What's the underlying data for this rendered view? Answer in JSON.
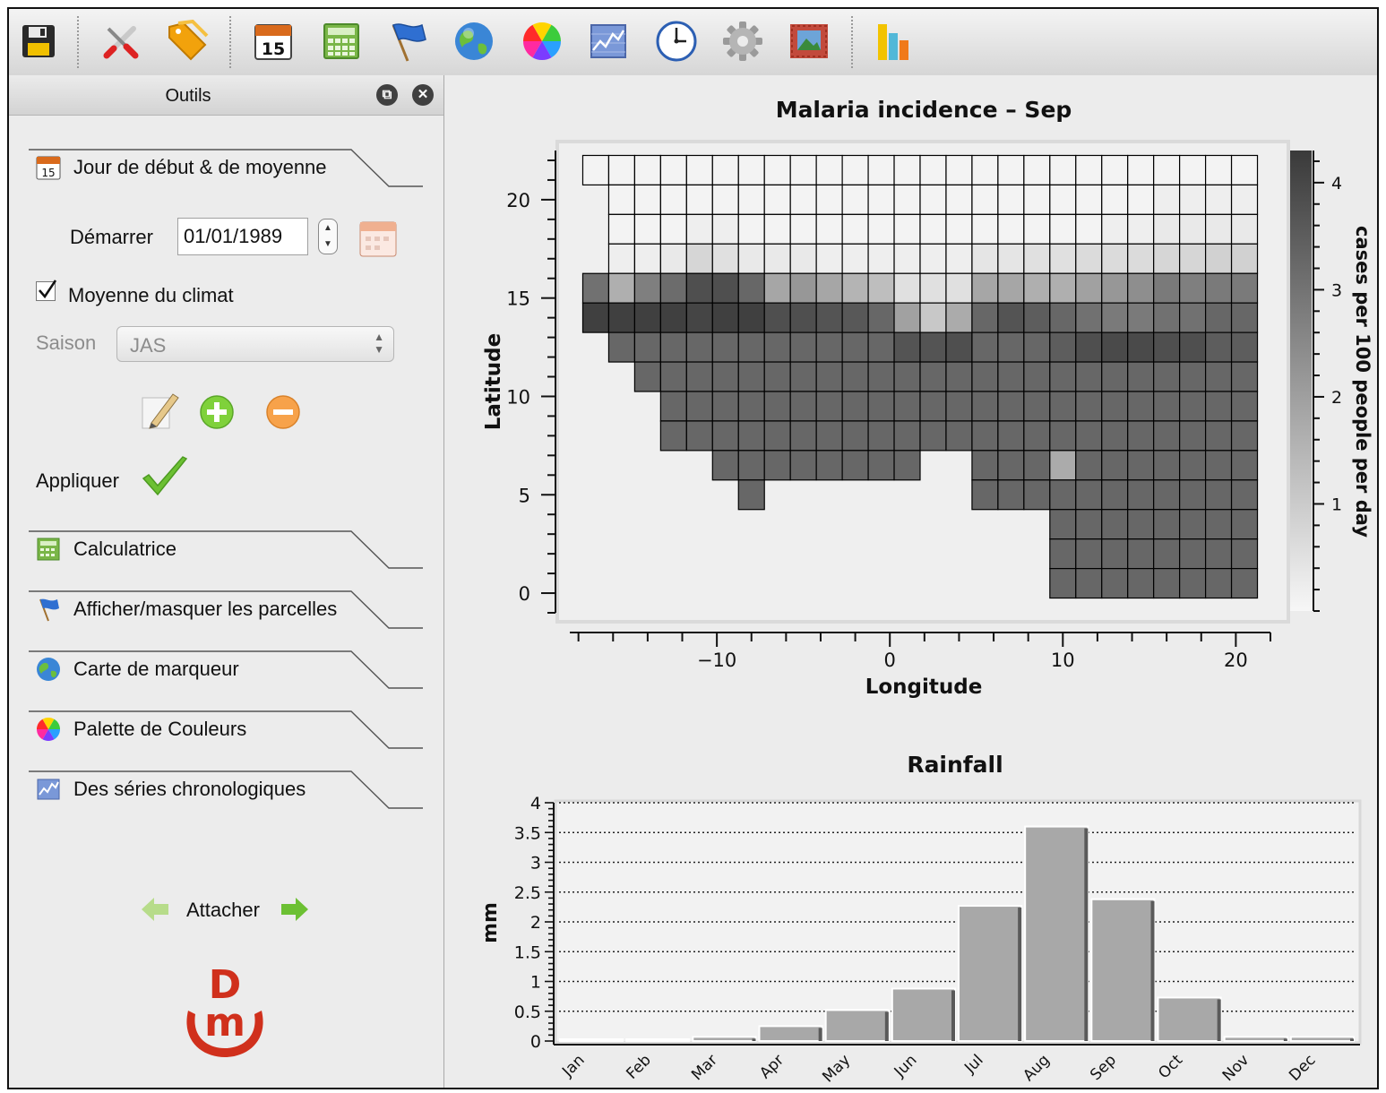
{
  "toolbar": {
    "buttons": [
      {
        "name": "save-icon"
      },
      {
        "name": "tools-icon"
      },
      {
        "name": "tag-icon"
      },
      {
        "name": "calendar-icon",
        "label": "15"
      },
      {
        "name": "calculator-icon"
      },
      {
        "name": "flag-icon"
      },
      {
        "name": "globe-icon"
      },
      {
        "name": "color-wheel-icon"
      },
      {
        "name": "timeseries-icon"
      },
      {
        "name": "clock-icon"
      },
      {
        "name": "gear-icon"
      },
      {
        "name": "image-icon"
      },
      {
        "name": "bar-chart-icon"
      }
    ]
  },
  "panel": {
    "title": "Outils",
    "tabs": {
      "start": "Jour de début & de moyenne",
      "calc": "Calculatrice",
      "plots": "Afficher/masquer les parcelles",
      "marker": "Carte de marqueur",
      "palette": "Palette de Couleurs",
      "series": "Des séries chronologiques"
    },
    "start_label": "Démarrer",
    "start_date": "01/01/1989",
    "calendar_day": "15",
    "climate_mean_label": "Moyenne du climat",
    "climate_mean_checked": true,
    "season_label": "Saison",
    "season_value": "JAS",
    "apply_label": "Appliquer",
    "attach_label": "Attacher",
    "logo_text": {
      "top": "D",
      "bottom": "m"
    }
  },
  "chart_data": [
    {
      "type": "heatmap",
      "title": "Malaria incidence – Sep",
      "xlabel": "Longitude",
      "ylabel": "Latitude",
      "colorbar_label": "cases per 100 people per day",
      "colorbar_range": [
        0,
        4.3
      ],
      "colorbar_ticks": [
        "1",
        "2",
        "3",
        "4"
      ],
      "xticks": [
        "-10",
        "0",
        "10",
        "20"
      ],
      "yticks": [
        "0",
        "5",
        "10",
        "15",
        "20"
      ],
      "x_range": [
        -18.5,
        22
      ],
      "y_range": [
        -1,
        22.5
      ],
      "lon_start": -17,
      "lat_start": 21.5,
      "cell_size": 1.5,
      "grid": [
        [
          0.1,
          0.1,
          0.1,
          0.1,
          0.1,
          0.1,
          0.1,
          0.1,
          0.1,
          0.1,
          0.1,
          0.1,
          0.1,
          0.1,
          0.1,
          0.1,
          0.1,
          0.1,
          0.1,
          0.1,
          0.1,
          0.1,
          0.1,
          0.1,
          0.1,
          0.1
        ],
        [
          null,
          0.1,
          0.1,
          0.1,
          0.1,
          0.1,
          0.1,
          0.1,
          0.1,
          0.1,
          0.1,
          0.1,
          0.1,
          0.1,
          0.1,
          0.1,
          0.1,
          0.1,
          0.1,
          0.1,
          0.1,
          0.1,
          0.2,
          0.2,
          0.2,
          0.2
        ],
        [
          null,
          0.1,
          0.1,
          0.1,
          0.2,
          0.2,
          0.1,
          0.1,
          0.1,
          0.1,
          0.1,
          0.1,
          0.1,
          0.1,
          0.1,
          0.1,
          0.1,
          0.1,
          0.1,
          0.1,
          0.2,
          0.2,
          0.3,
          0.3,
          0.3,
          0.3
        ],
        [
          null,
          0.2,
          0.2,
          0.3,
          0.7,
          0.5,
          0.3,
          0.3,
          0.3,
          0.2,
          0.2,
          0.2,
          0.2,
          0.2,
          0.2,
          0.4,
          0.4,
          0.5,
          0.5,
          0.6,
          0.6,
          0.6,
          0.7,
          0.7,
          0.8,
          0.8
        ],
        [
          2.8,
          1.5,
          2.5,
          2.9,
          3.5,
          3.5,
          3.0,
          1.7,
          2.0,
          1.7,
          1.4,
          1.2,
          0.5,
          0.5,
          0.5,
          1.7,
          1.7,
          1.5,
          1.5,
          1.8,
          2.0,
          2.2,
          2.6,
          2.5,
          2.6,
          2.6
        ],
        [
          3.8,
          3.8,
          3.8,
          3.8,
          3.7,
          3.8,
          3.8,
          3.5,
          3.5,
          3.4,
          3.3,
          3.0,
          1.8,
          1.0,
          1.6,
          3.0,
          3.4,
          3.2,
          3.0,
          2.8,
          2.6,
          2.6,
          2.8,
          2.8,
          3.0,
          3.0
        ],
        [
          null,
          3.0,
          3.0,
          3.0,
          3.0,
          3.0,
          3.0,
          3.0,
          3.0,
          3.0,
          3.0,
          3.0,
          3.4,
          3.4,
          3.5,
          3.0,
          3.0,
          3.0,
          3.2,
          3.5,
          3.6,
          3.6,
          3.5,
          3.5,
          3.2,
          3.2
        ],
        [
          null,
          null,
          3.0,
          3.0,
          3.0,
          3.0,
          3.0,
          3.0,
          3.0,
          3.0,
          3.0,
          3.0,
          3.0,
          3.0,
          3.0,
          3.0,
          3.0,
          3.0,
          3.0,
          3.0,
          3.0,
          3.0,
          3.0,
          3.0,
          3.0,
          3.0
        ],
        [
          null,
          null,
          null,
          3.0,
          3.0,
          3.0,
          3.0,
          3.0,
          3.0,
          3.0,
          3.0,
          3.0,
          3.0,
          3.0,
          3.0,
          3.0,
          3.0,
          3.0,
          3.0,
          3.0,
          3.0,
          3.0,
          3.0,
          3.0,
          3.0,
          3.0
        ],
        [
          null,
          null,
          null,
          3.0,
          3.0,
          3.0,
          3.0,
          3.0,
          3.0,
          3.0,
          3.0,
          3.0,
          3.0,
          3.0,
          3.0,
          3.0,
          3.0,
          3.0,
          3.0,
          3.0,
          3.0,
          3.0,
          3.0,
          3.0,
          3.0,
          3.0
        ],
        [
          null,
          null,
          null,
          null,
          null,
          3.0,
          3.0,
          3.0,
          3.0,
          3.0,
          3.0,
          3.0,
          3.0,
          null,
          null,
          3.0,
          3.0,
          3.0,
          1.6,
          3.0,
          3.0,
          3.0,
          3.0,
          3.0,
          3.0,
          3.0
        ],
        [
          null,
          null,
          null,
          null,
          null,
          null,
          3.0,
          null,
          null,
          null,
          null,
          null,
          null,
          null,
          null,
          3.0,
          3.0,
          3.0,
          3.0,
          3.0,
          3.0,
          3.0,
          3.0,
          3.0,
          3.0,
          3.0
        ],
        [
          null,
          null,
          null,
          null,
          null,
          null,
          null,
          null,
          null,
          null,
          null,
          null,
          null,
          null,
          null,
          null,
          null,
          null,
          3.0,
          3.0,
          3.0,
          3.0,
          3.0,
          3.0,
          3.0,
          3.0
        ],
        [
          null,
          null,
          null,
          null,
          null,
          null,
          null,
          null,
          null,
          null,
          null,
          null,
          null,
          null,
          null,
          null,
          null,
          null,
          3.0,
          3.0,
          3.0,
          3.0,
          3.0,
          3.0,
          3.0,
          3.0
        ],
        [
          null,
          null,
          null,
          null,
          null,
          null,
          null,
          null,
          null,
          null,
          null,
          null,
          null,
          null,
          null,
          null,
          null,
          null,
          3.0,
          3.0,
          3.0,
          3.0,
          3.0,
          3.0,
          3.0,
          3.0
        ]
      ]
    },
    {
      "type": "bar",
      "title": "Rainfall",
      "ylabel": "mm",
      "categories": [
        "Jan",
        "Feb",
        "Mar",
        "Apr",
        "May",
        "Jun",
        "Jul",
        "Aug",
        "Sep",
        "Oct",
        "Nov",
        "Dec"
      ],
      "values": [
        0.0,
        0.0,
        0.07,
        0.25,
        0.52,
        0.88,
        2.27,
        3.6,
        2.38,
        0.73,
        0.07,
        0.07
      ],
      "ylim": [
        0,
        4
      ],
      "yticks": [
        "0",
        "0.5",
        "1",
        "1.5",
        "2",
        "2.5",
        "3",
        "3.5",
        "4"
      ],
      "grid": true
    }
  ]
}
